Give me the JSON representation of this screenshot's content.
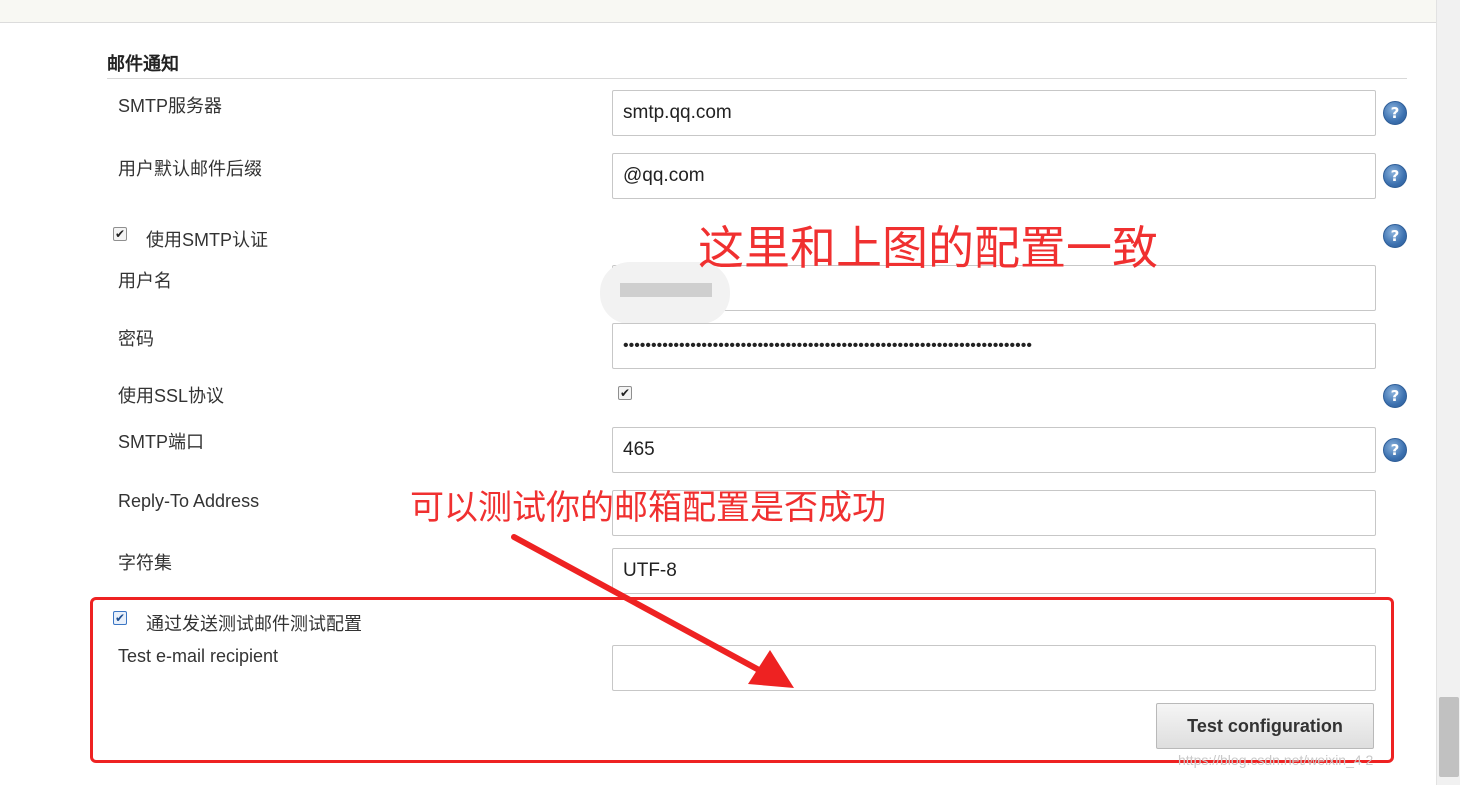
{
  "section": {
    "title": "邮件通知"
  },
  "fields": {
    "smtp_server": {
      "label": "SMTP服务器",
      "value": "smtp.qq.com"
    },
    "default_suffix": {
      "label": "用户默认邮件后缀",
      "value": "@qq.com"
    },
    "use_smtp_auth": {
      "label": "使用SMTP认证",
      "checked": true
    },
    "username": {
      "label": "用户名",
      "value": ""
    },
    "password": {
      "label": "密码",
      "value": "•••••••••••••••••••••••••••••••••••••••••••••••••••••••••••••••••••••••••"
    },
    "use_ssl": {
      "label": "使用SSL协议",
      "checked": true
    },
    "smtp_port": {
      "label": "SMTP端口",
      "value": "465"
    },
    "reply_to": {
      "label": "Reply-To Address",
      "value": ""
    },
    "charset": {
      "label": "字符集",
      "value": "UTF-8"
    },
    "test_by_email": {
      "label": "通过发送测试邮件测试配置",
      "checked": true
    },
    "test_recipient": {
      "label": "Test e-mail recipient",
      "value": ""
    }
  },
  "buttons": {
    "test_configuration": "Test configuration"
  },
  "help_icon_glyph": "?",
  "checkbox_glyph": "✔",
  "annotations": {
    "config_note": "这里和上图的配置一致",
    "test_note": "可以测试你的邮箱配置是否成功"
  },
  "colors": {
    "annotation": "#f03030",
    "help": "#3c71b0"
  },
  "watermark": "https://blog.csdn.net/weixin_4    2"
}
